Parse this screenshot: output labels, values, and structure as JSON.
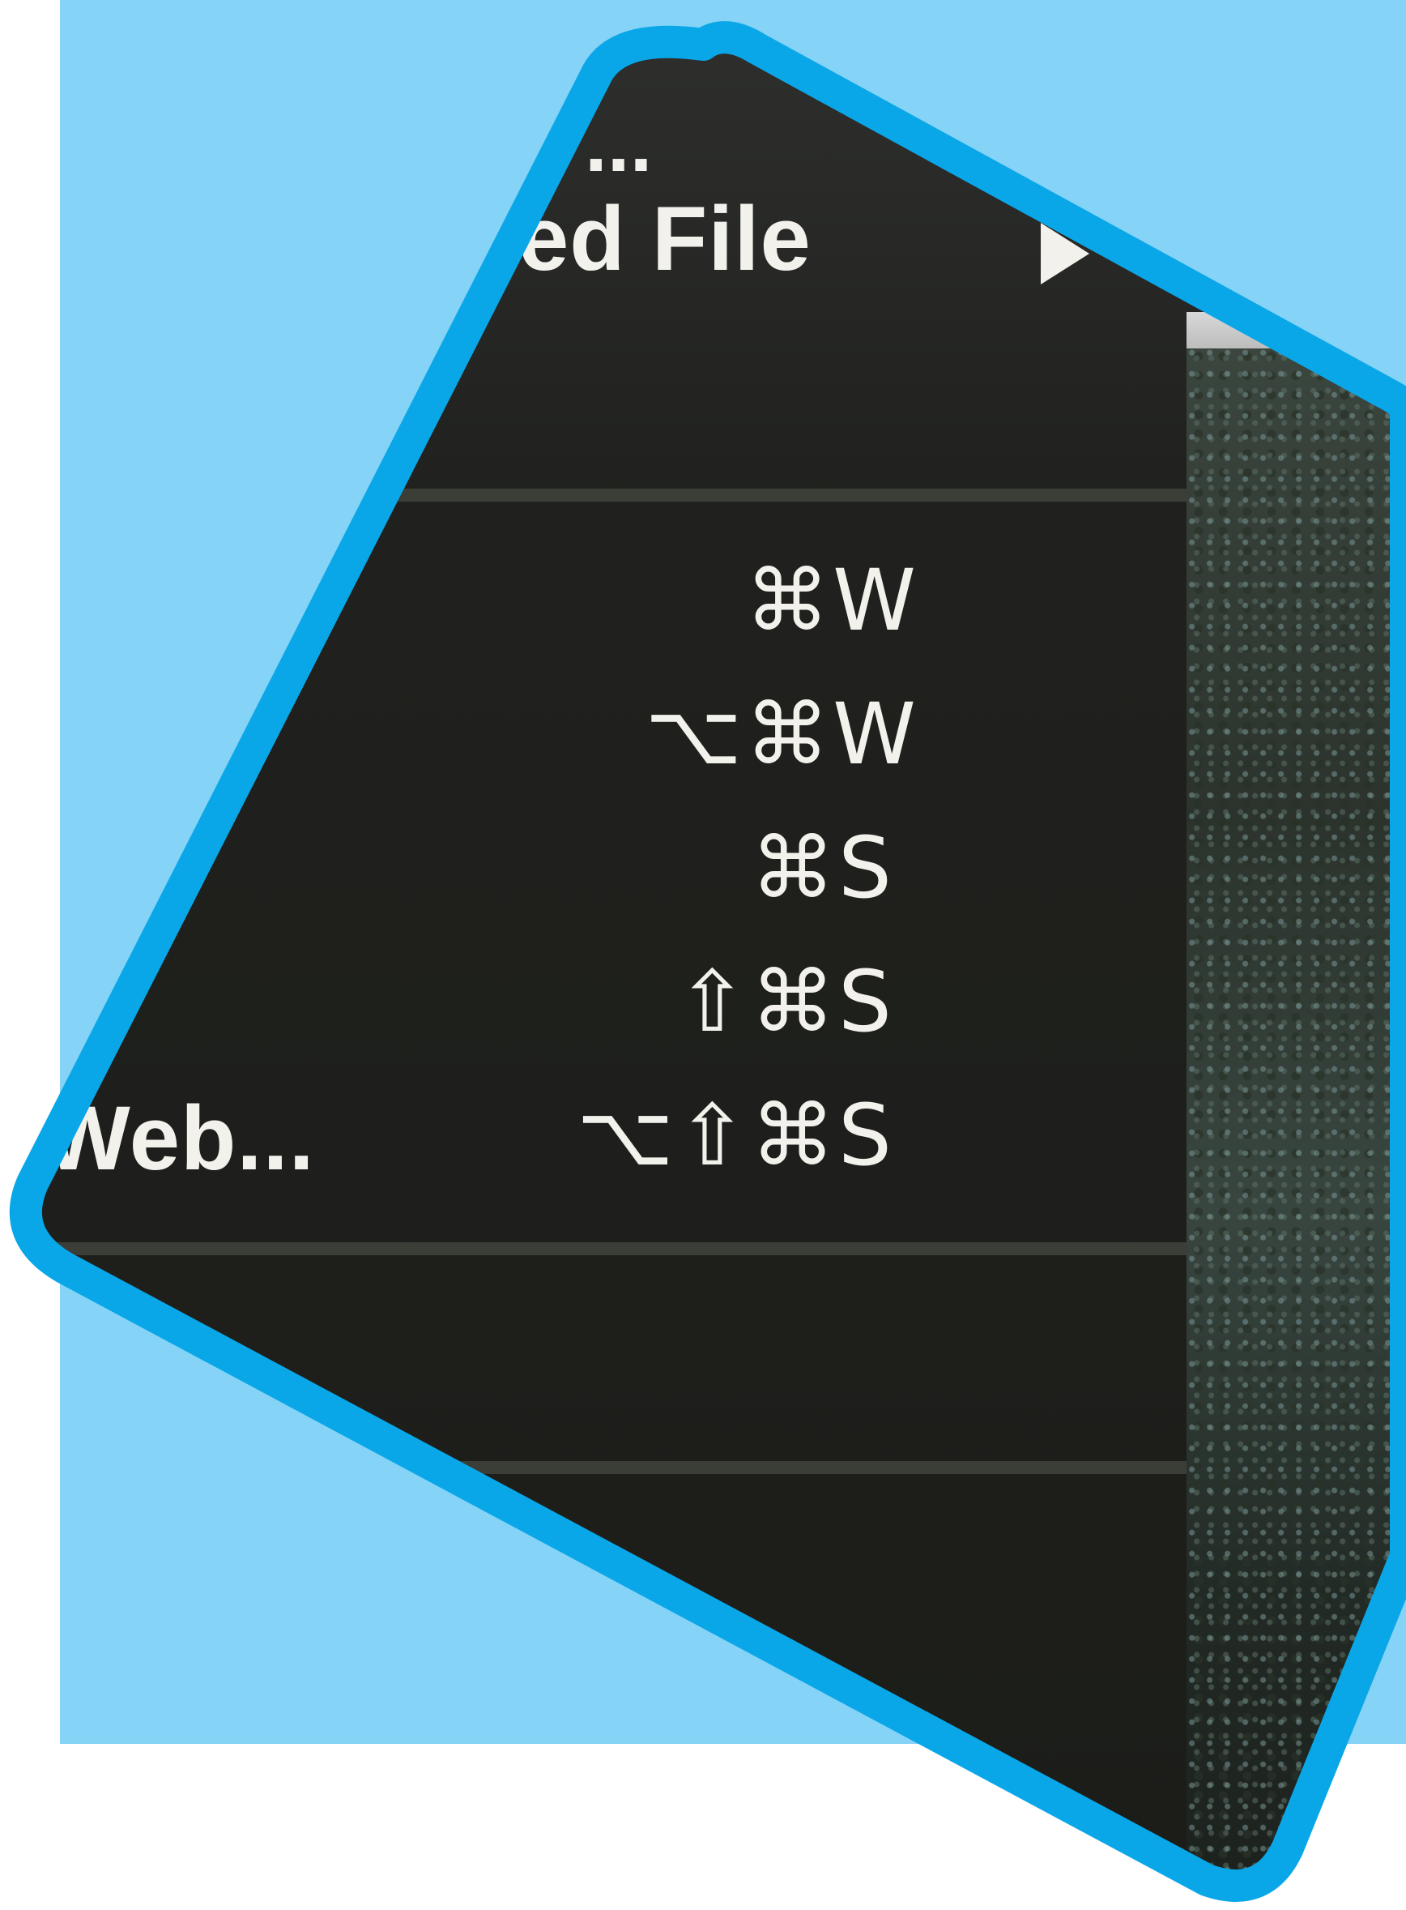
{
  "colors": {
    "backdrop": "#85d3f6",
    "tile_border": "#0aa7e8",
    "menu_bg": "#1e1e1b",
    "separator": "#3b3d37",
    "text": "#f2f1ec"
  },
  "menu": {
    "top_ellipsis": "...",
    "submenu_item": {
      "label": "ed File",
      "icon": "submenu-arrow-icon"
    },
    "items": [
      {
        "shortcut": "⌘W"
      },
      {
        "shortcut": "⌥⌘W"
      },
      {
        "shortcut": "⌘S"
      },
      {
        "shortcut": "⇧⌘S"
      },
      {
        "label": "Web...",
        "shortcut": "⌥⇧⌘S"
      }
    ]
  }
}
